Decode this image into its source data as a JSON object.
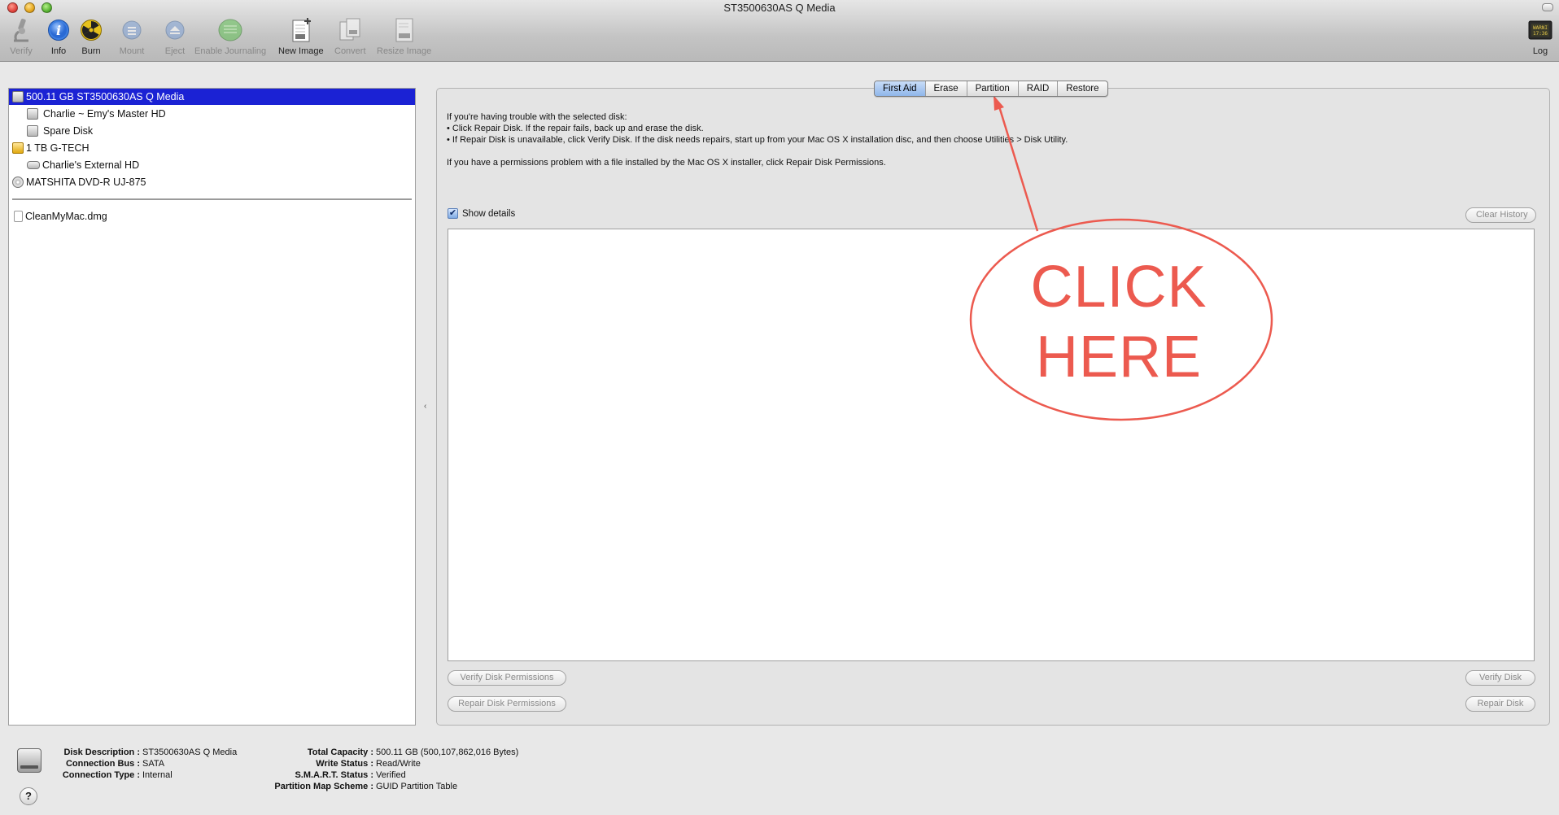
{
  "window": {
    "title": "ST3500630AS Q Media"
  },
  "toolbar": {
    "verify": "Verify",
    "info": "Info",
    "burn": "Burn",
    "mount": "Mount",
    "eject": "Eject",
    "enable_journaling": "Enable Journaling",
    "new_image": "New Image",
    "convert": "Convert",
    "resize_image": "Resize Image",
    "log": "Log",
    "log_icon_text": "WARNI\n17:36"
  },
  "sidebar": {
    "items": [
      {
        "label": "500.11 GB ST3500630AS Q Media",
        "icon": "hard-drive-icon",
        "selected": true
      },
      {
        "label": "Charlie ~ Emy's Master HD",
        "icon": "volume-icon"
      },
      {
        "label": "Spare Disk",
        "icon": "volume-icon"
      },
      {
        "label": "1 TB G-TECH",
        "icon": "external-drive-icon"
      },
      {
        "label": "Charlie's External HD",
        "icon": "external-volume-icon"
      },
      {
        "label": "MATSHITA DVD-R UJ-875",
        "icon": "optical-drive-icon"
      },
      {
        "label": "CleanMyMac.dmg",
        "icon": "disk-image-icon"
      }
    ]
  },
  "tabs": [
    {
      "label": "First Aid",
      "active": true
    },
    {
      "label": "Erase"
    },
    {
      "label": "Partition"
    },
    {
      "label": "RAID"
    },
    {
      "label": "Restore"
    }
  ],
  "first_aid": {
    "intro": "If you're having trouble with the selected disk:",
    "bullet1": "•  Click Repair Disk. If the repair fails, back up and erase the disk.",
    "bullet2": "•  If Repair Disk is unavailable, click Verify Disk. If the disk needs repairs, start up from your Mac OS X installation disc, and then choose Utilities > Disk Utility.",
    "permissions_note": "If you have a permissions problem with a file installed by the Mac OS X installer, click Repair Disk Permissions.",
    "show_details_label": "Show details",
    "show_details_checked": true,
    "clear_history": "Clear History",
    "verify_permissions": "Verify Disk Permissions",
    "repair_permissions": "Repair Disk Permissions",
    "verify_disk": "Verify Disk",
    "repair_disk": "Repair Disk"
  },
  "disk_info": {
    "left": [
      {
        "key": "Disk Description :",
        "value": "ST3500630AS Q Media"
      },
      {
        "key": "Connection Bus :",
        "value": "SATA"
      },
      {
        "key": "Connection Type :",
        "value": "Internal"
      }
    ],
    "right": [
      {
        "key": "Total Capacity :",
        "value": "500.11 GB (500,107,862,016 Bytes)"
      },
      {
        "key": "Write Status :",
        "value": "Read/Write"
      },
      {
        "key": "S.M.A.R.T. Status :",
        "value": "Verified"
      },
      {
        "key": "Partition Map Scheme :",
        "value": "GUID Partition Table"
      }
    ],
    "help": "?"
  },
  "annotation": {
    "line1": "CLICK",
    "line2": "HERE",
    "color": "#ec5a4f"
  }
}
